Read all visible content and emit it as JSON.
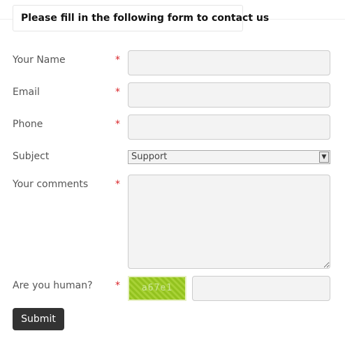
{
  "form": {
    "legend": "Please fill in the following form to contact us",
    "required_mark": "*",
    "fields": {
      "name": {
        "label": "Your Name",
        "value": ""
      },
      "email": {
        "label": "Email",
        "value": ""
      },
      "phone": {
        "label": "Phone",
        "value": ""
      },
      "subject": {
        "label": "Subject",
        "selected": "Support"
      },
      "comments": {
        "label": "Your comments",
        "value": ""
      },
      "captcha": {
        "label": "Are you human?",
        "code": "a67e1",
        "value": ""
      }
    },
    "submit_label": "Submit"
  },
  "colors": {
    "required": "#d9252a",
    "button_bg": "#333333",
    "input_bg": "#f3f3f3",
    "captcha_green": "#9ccb2a"
  }
}
